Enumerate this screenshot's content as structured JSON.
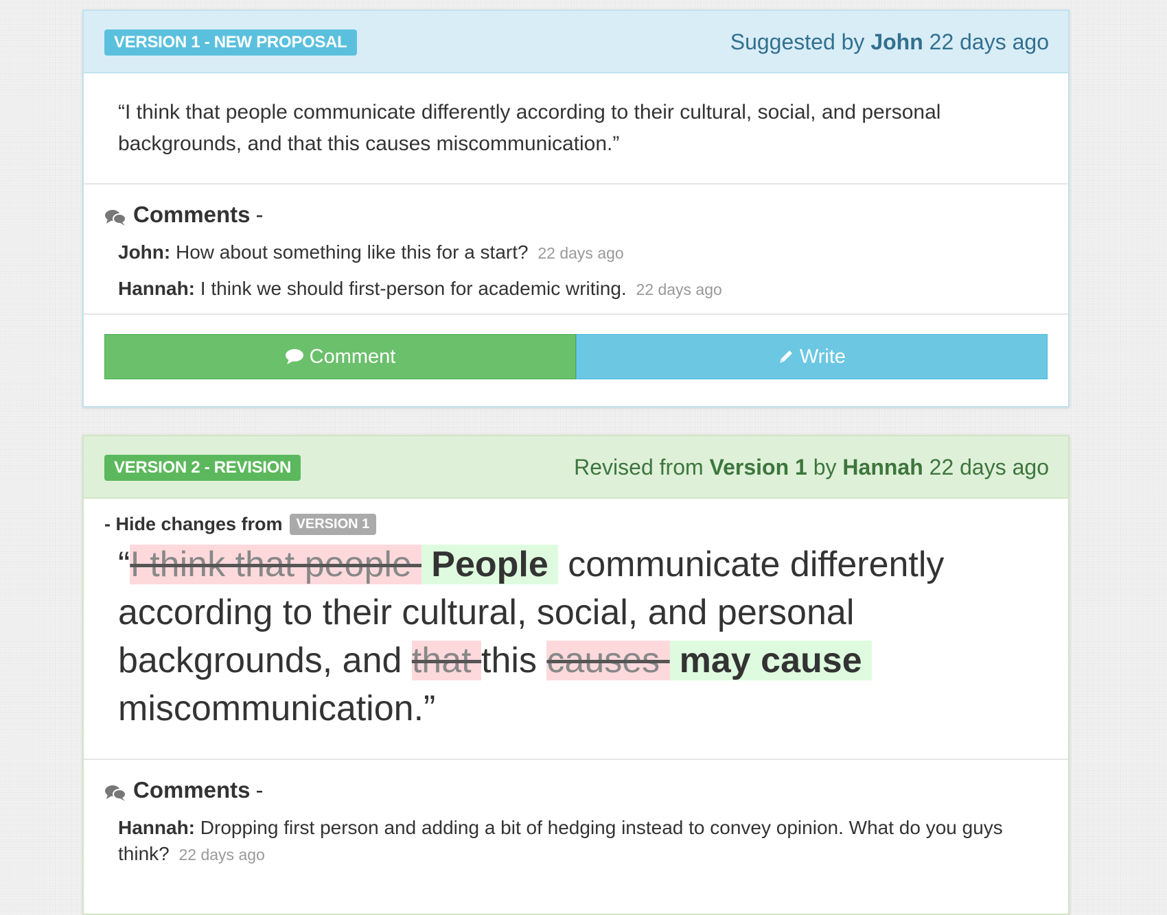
{
  "v1": {
    "badge": "VERSION 1 - NEW PROPOSAL",
    "meta_prefix": "Suggested by",
    "author": "John",
    "time": "22 days ago",
    "quote": "“I think that people communicate differently according to their cultural, social, and personal backgrounds, and that this causes miscommunication.”",
    "comments_title": "Comments",
    "comments_dash": "-",
    "comments": [
      {
        "who": "John:",
        "text": "How about something like this for a start?",
        "when": "22 days ago"
      },
      {
        "who": "Hannah:",
        "text": "I think we should first-person for academic writing.",
        "when": "22 days ago"
      }
    ],
    "comment_button": "Comment",
    "write_button": "Write"
  },
  "v2": {
    "badge": "VERSION 2 - REVISION",
    "meta_prefix": "Revised from",
    "from_version": "Version 1",
    "by": "by",
    "author": "Hannah",
    "time": "22 days ago",
    "hide_changes": "- Hide changes from",
    "changes_badge": "VERSION 1",
    "rev": {
      "open_quote": "“",
      "del1": "I think that people ",
      "ins1": "People",
      "t1": " communicate differently according to their cultural, social, and personal backgrounds, and ",
      "del2": "that ",
      "t2": "this ",
      "del3": "causes ",
      "ins2": "may cause",
      "t3": " miscommunication.”"
    },
    "comments_title": "Comments",
    "comments_dash": "-",
    "comments": [
      {
        "who": "Hannah:",
        "text": "Dropping first person and adding a bit of hedging instead to convey opinion. What do you guys think?",
        "when": "22 days ago"
      }
    ]
  },
  "icons": {
    "comments": "comments-icon",
    "comment": "comment-bubble-icon",
    "write": "pencil-icon"
  },
  "colors": {
    "info": "#5bc0de",
    "success": "#5cb85c",
    "deleted_bg": "#fdd9dc",
    "inserted_bg": "#dffbdf"
  }
}
